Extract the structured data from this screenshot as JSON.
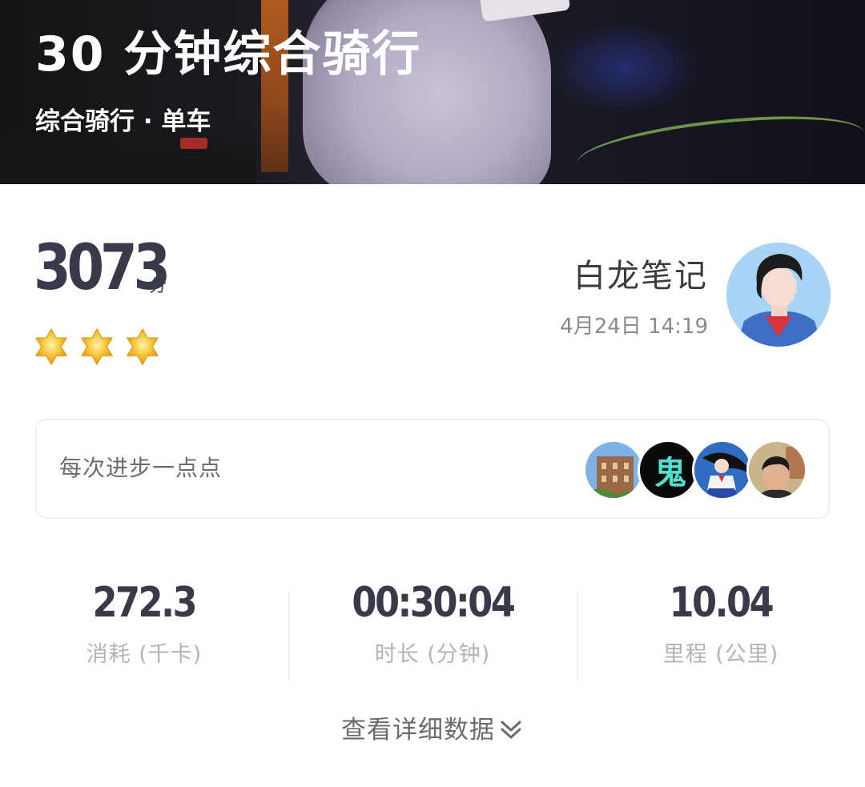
{
  "header": {
    "title": "30 分钟综合骑行",
    "subtitle": "综合骑行 · 单车"
  },
  "score": {
    "value": "3073",
    "unit": "分",
    "stars": 3
  },
  "user": {
    "name": "白龙笔记",
    "time": "4月24日 14:19",
    "avatar_icon": "user-avatar-icon"
  },
  "motto": {
    "text": "每次进步一点点",
    "liker_avatars": [
      "liker-avatar-building",
      "liker-avatar-gui",
      "liker-avatar-anime",
      "liker-avatar-man"
    ],
    "gui_char": "鬼"
  },
  "stats": [
    {
      "value": "272.3",
      "label": "消耗 (千卡)"
    },
    {
      "value": "00:30:04",
      "label": "时长 (分钟)"
    },
    {
      "value": "10.04",
      "label": "里程 (公里)"
    }
  ],
  "details": {
    "label": "查看详细数据",
    "icon": "double-chevron-down-icon"
  },
  "colors": {
    "score_text": "#383a4a",
    "star": "#f6b81c",
    "label_gray": "#b4b4b4"
  }
}
